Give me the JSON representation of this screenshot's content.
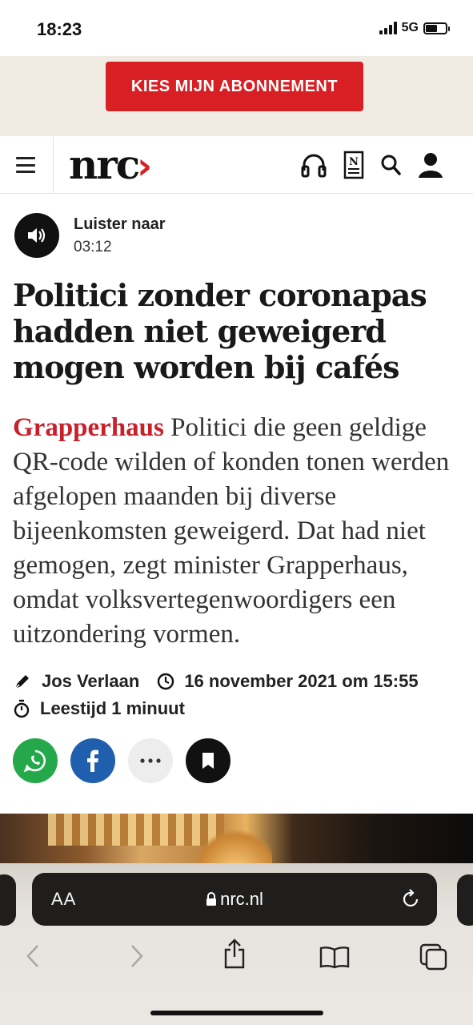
{
  "status_bar": {
    "time": "18:23",
    "network": "5G"
  },
  "promo": {
    "button_label": "KIES MIJN ABONNEMENT"
  },
  "nav": {
    "logo_text": "nrc",
    "logo_mark": "›",
    "icons": [
      "headphones-icon",
      "newspaper-icon",
      "search-icon",
      "user-icon"
    ]
  },
  "audio": {
    "label": "Luister naar",
    "duration": "03:12"
  },
  "article": {
    "headline": "Politici zonder coronapas hadden niet geweigerd mogen worden bij cafés",
    "kicker": "Grapperhaus",
    "intro": "Politici die geen geldige QR-code wilden of konden tonen werden afgelopen maanden bij diverse bijeenkomsten geweigerd. Dat had niet gemogen, zegt minister Grapperhaus, omdat volksvertegenwoordigers een uitzondering vormen.",
    "author": "Jos Verlaan",
    "date": "16 november 2021 om 15:55",
    "reading_time": "Leestijd 1 minuut"
  },
  "share": {
    "buttons": [
      {
        "name": "whatsapp",
        "color": "#25a84a"
      },
      {
        "name": "facebook",
        "color": "#1f5fae"
      },
      {
        "name": "more",
        "color": "#ededed"
      },
      {
        "name": "bookmark",
        "color": "#111111"
      }
    ]
  },
  "browser": {
    "text_size_label": "AA",
    "url": "nrc.nl"
  },
  "colors": {
    "accent": "#d82024",
    "kicker": "#c8202a"
  }
}
